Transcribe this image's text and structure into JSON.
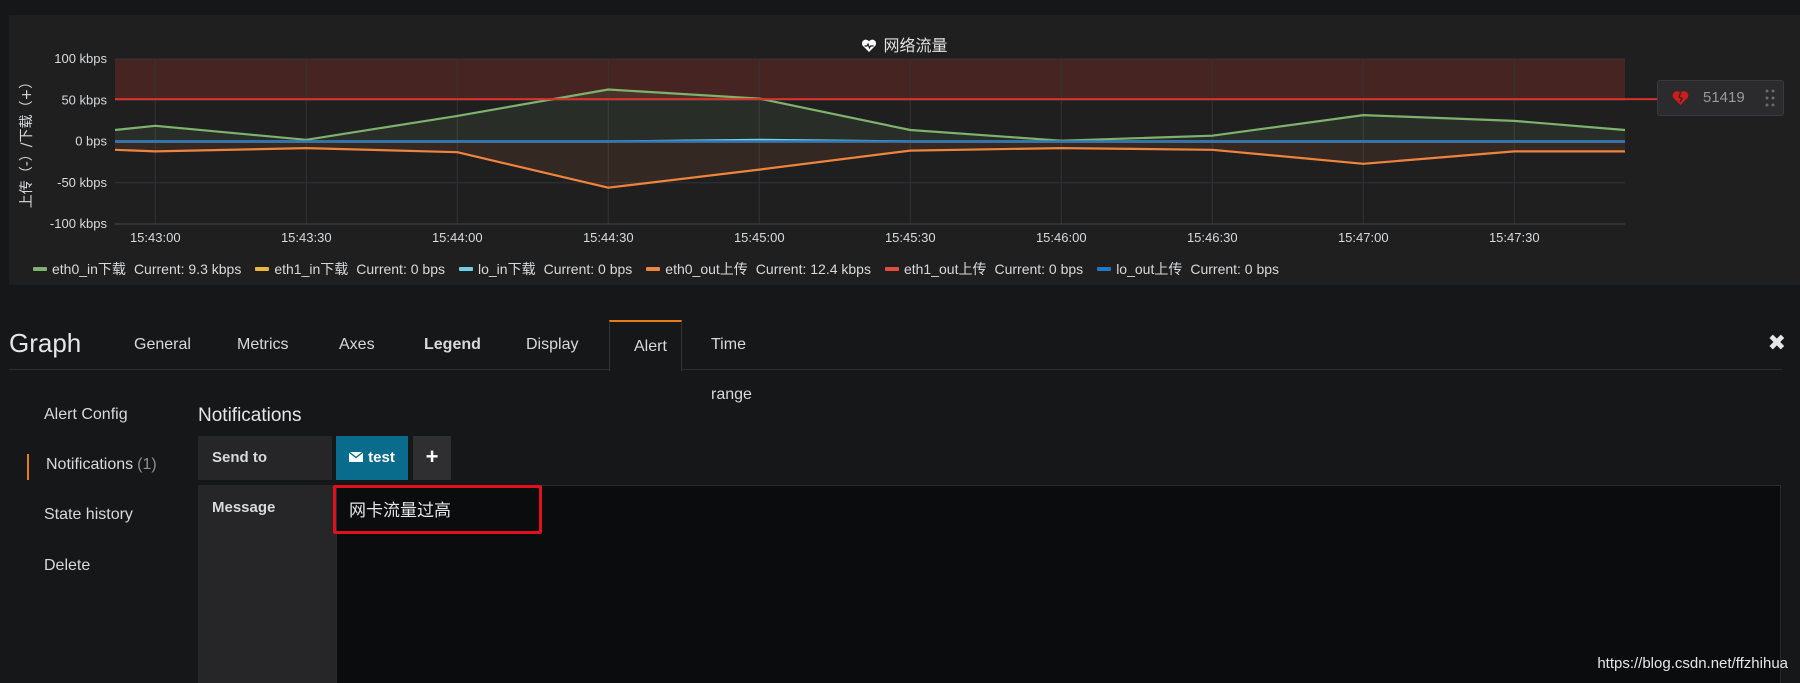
{
  "panel": {
    "title": "网络流量",
    "threshold": {
      "value": "51419"
    }
  },
  "chart_data": {
    "type": "line",
    "title": "网络流量",
    "ylabel": "上传（-）/下载（+）",
    "ylim": [
      -100,
      100
    ],
    "y_ticks": [
      "100 kbps",
      "50 kbps",
      "0 bps",
      "-50 kbps",
      "-100 kbps"
    ],
    "y_tick_values": [
      100,
      50,
      0,
      -50,
      -100
    ],
    "x_ticks": [
      "15:43:00",
      "15:43:30",
      "15:44:00",
      "15:44:30",
      "15:45:00",
      "15:45:30",
      "15:46:00",
      "15:46:30",
      "15:47:00",
      "15:47:30"
    ],
    "x": [
      "15:42:52",
      "15:43:00",
      "15:43:30",
      "15:44:00",
      "15:44:30",
      "15:45:00",
      "15:45:30",
      "15:46:00",
      "15:46:30",
      "15:47:00",
      "15:47:30",
      "15:47:52"
    ],
    "threshold": 51.419,
    "grid": true,
    "legend_position": "bottom",
    "series": [
      {
        "name": "eth0_in下载",
        "color": "#7eb26d",
        "current": "Current: 9.3 kbps",
        "values": [
          14,
          19,
          2,
          31,
          63,
          52,
          14,
          1,
          7,
          32,
          25,
          14
        ]
      },
      {
        "name": "eth1_in下载",
        "color": "#eab839",
        "current": "Current: 0 bps",
        "values": [
          0,
          0,
          0,
          0,
          0,
          0,
          0,
          0,
          0,
          0,
          0,
          0
        ]
      },
      {
        "name": "lo_in下载",
        "color": "#6ed0e0",
        "current": "Current: 0 bps",
        "values": [
          0,
          0,
          0,
          0,
          0,
          2,
          0,
          0,
          0,
          0,
          0,
          0
        ]
      },
      {
        "name": "eth0_out上传",
        "color": "#ef843c",
        "current": "Current: 12.4 kbps",
        "values": [
          -10,
          -12,
          -8,
          -13,
          -56,
          -34,
          -11,
          -8,
          -10,
          -27,
          -12,
          -12
        ]
      },
      {
        "name": "eth1_out上传",
        "color": "#e24d42",
        "current": "Current: 0 bps",
        "values": [
          0,
          0,
          0,
          0,
          0,
          0,
          0,
          0,
          0,
          0,
          0,
          0
        ]
      },
      {
        "name": "lo_out上传",
        "color": "#1f78c1",
        "current": "Current: 0 bps",
        "values": [
          0,
          0,
          0,
          0,
          0,
          0,
          0,
          0,
          0,
          0,
          0,
          0
        ]
      }
    ]
  },
  "editor": {
    "title": "Graph",
    "tabs": [
      "General",
      "Metrics",
      "Axes",
      "Legend",
      "Display",
      "Alert",
      "Time range"
    ],
    "active_tab": "Alert"
  },
  "side_nav": {
    "items": [
      {
        "label": "Alert Config"
      },
      {
        "label": "Notifications",
        "count": "(1)"
      },
      {
        "label": "State history"
      },
      {
        "label": "Delete"
      }
    ],
    "active": "Notifications"
  },
  "notifications": {
    "title": "Notifications",
    "send_to_label": "Send to",
    "channel": "test",
    "add_label": "+",
    "message_label": "Message",
    "message_value": "网卡流量过高"
  },
  "watermark": "https://blog.csdn.net/ffzhihua"
}
